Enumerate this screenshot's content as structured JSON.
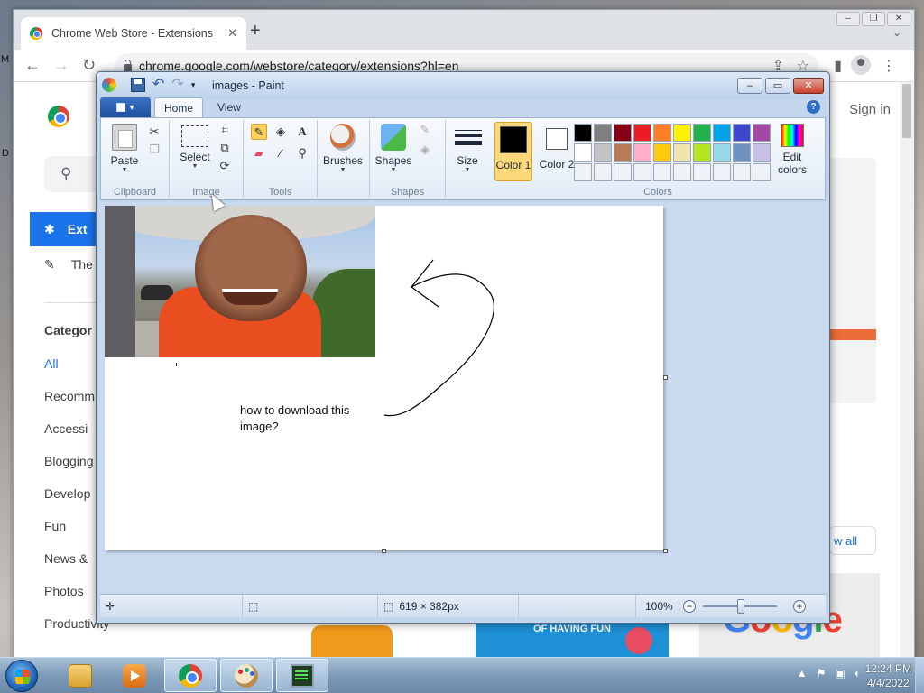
{
  "chrome": {
    "tab_title": "Chrome Web Store - Extensions",
    "tab_close": "✕",
    "new_tab": "+",
    "url": "chrome.google.com/webstore/category/extensions?hl=en",
    "back": "←",
    "forward": "→",
    "reload": "↻",
    "share": "⇪",
    "star": "☆",
    "more": "⋮",
    "side_panel": "▮",
    "tab_list": "⌄"
  },
  "store": {
    "sign_in": "Sign in",
    "search_icon_glyph": "⚲",
    "sidebar": [
      {
        "label": "Ext",
        "icon": "puzzle-icon",
        "active": true
      },
      {
        "label": "The",
        "icon": "brush-icon",
        "active": false
      }
    ],
    "categories_title": "Categor",
    "categories": [
      "All",
      "Recomm",
      "Accessi",
      "Blogging",
      "Develop",
      "Fun",
      "News &",
      "Photos",
      "Productivity"
    ],
    "view_all": "w all",
    "banner_text": "OF HAVING FUN",
    "google_text": "Google",
    "left_edge_m": "M",
    "left_edge_d": "D"
  },
  "paint": {
    "title": "images - Paint",
    "tabs": [
      "Home",
      "View"
    ],
    "help": "?",
    "groups": {
      "clipboard": {
        "label": "Clipboard",
        "paste": "Paste"
      },
      "image": {
        "label": "Image",
        "select": "Select"
      },
      "tools": {
        "label": "Tools"
      },
      "brushes": {
        "label": "Brushes"
      },
      "shapes": {
        "label": "Shapes",
        "button": "Shapes"
      },
      "size": {
        "label": "Size"
      },
      "colors": {
        "label": "Colors",
        "color1": "Color 1",
        "color2": "Color 2",
        "edit_colors": "Edit colors",
        "color1_value": "#000000",
        "color2_value": "#ffffff",
        "palette": [
          "#000000",
          "#7f7f7f",
          "#880015",
          "#ed1c24",
          "#ff7f27",
          "#fff200",
          "#22b14c",
          "#00a2e8",
          "#3f48cc",
          "#a349a4",
          "#ffffff",
          "#c3c3c3",
          "#b97a57",
          "#ffaec9",
          "#ffc90e",
          "#efe4b0",
          "#b5e61d",
          "#99d9ea",
          "#7092be",
          "#c8bfe7",
          "#eef2f7",
          "#eef2f7",
          "#eef2f7",
          "#eef2f7",
          "#eef2f7",
          "#eef2f7",
          "#eef2f7",
          "#eef2f7",
          "#eef2f7",
          "#eef2f7"
        ]
      }
    },
    "canvas_note": "how to download this image?",
    "status": {
      "canvas_size": "619 × 382px",
      "zoom": "100%",
      "zoom_fraction": 0.5
    }
  },
  "taskbar": {
    "time": "12:24 PM",
    "date": "4/4/2022",
    "apps": [
      "file-explorer-icon",
      "media-player-icon",
      "chrome-icon",
      "paint-icon",
      "terminal-icon"
    ]
  }
}
